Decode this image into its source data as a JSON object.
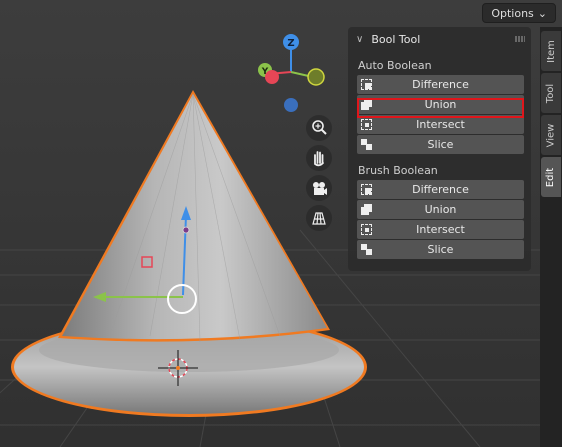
{
  "viewport": {
    "options_label": "Options",
    "gizmo": {
      "z_label": "Z",
      "y_label": "Y"
    }
  },
  "panel": {
    "title": "Bool Tool",
    "auto_boolean": {
      "label": "Auto Boolean",
      "buttons": [
        "Difference",
        "Union",
        "Intersect",
        "Slice"
      ]
    },
    "brush_boolean": {
      "label": "Brush Boolean",
      "buttons": [
        "Difference",
        "Union",
        "Intersect",
        "Slice"
      ]
    },
    "highlighted_button": "Union"
  },
  "sidebar_tabs": [
    "Item",
    "Tool",
    "View",
    "Edit"
  ],
  "active_tab": "Edit",
  "colors": {
    "selection_outline": "#f07a21",
    "highlight_box": "#e0161b",
    "axis_x": "#e64656",
    "axis_y": "#8bc34a",
    "axis_z": "#3f8fe8"
  }
}
